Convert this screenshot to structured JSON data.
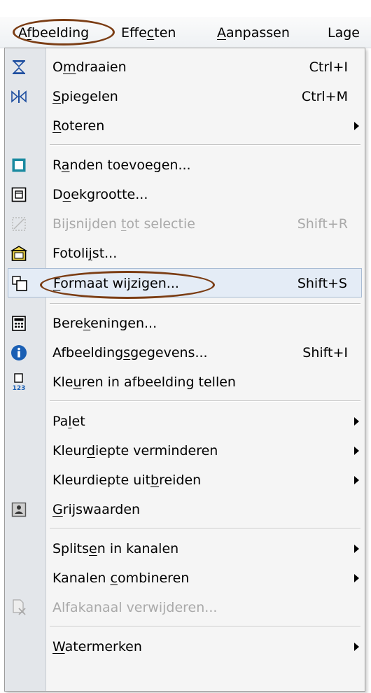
{
  "menubar": {
    "items": [
      {
        "label": "Afbeelding"
      },
      {
        "label": "Effecten"
      },
      {
        "label": "Aanpassen"
      },
      {
        "label": "Lage"
      }
    ]
  },
  "menu": {
    "items": [
      {
        "label": "Omdraaien",
        "shortcut": "Ctrl+I",
        "icon": "flip-vertical-icon"
      },
      {
        "label": "Spiegelen",
        "shortcut": "Ctrl+M",
        "icon": "mirror-icon"
      },
      {
        "label": "Roteren",
        "submenu": true
      },
      {
        "label": "Randen toevoegen...",
        "icon": "add-border-icon"
      },
      {
        "label": "Doekgrootte...",
        "icon": "canvas-size-icon"
      },
      {
        "label": "Bijsnijden tot selectie",
        "shortcut": "Shift+R",
        "icon": "crop-icon",
        "disabled": true
      },
      {
        "label": "Fotolijst...",
        "icon": "frame-icon"
      },
      {
        "label": "Formaat wijzigen...",
        "shortcut": "Shift+S",
        "icon": "resize-icon",
        "selected": true
      },
      {
        "label": "Berekeningen...",
        "icon": "calculator-icon"
      },
      {
        "label": "Afbeeldingsgegevens...",
        "shortcut": "Shift+I",
        "icon": "info-icon"
      },
      {
        "label": "Kleuren in afbeelding tellen",
        "icon": "count-colors-icon"
      },
      {
        "label": "Palet",
        "submenu": true
      },
      {
        "label": "Kleurdiepte verminderen",
        "submenu": true
      },
      {
        "label": "Kleurdiepte uitbreiden",
        "submenu": true
      },
      {
        "label": "Grijswaarden",
        "icon": "grayscale-icon"
      },
      {
        "label": "Splitsen in kanalen",
        "submenu": true
      },
      {
        "label": "Kanalen combineren",
        "submenu": true
      },
      {
        "label": "Alfakanaal verwijderen...",
        "icon": "delete-alpha-icon",
        "disabled": true
      },
      {
        "label": "Watermerken",
        "submenu": true
      }
    ]
  },
  "colors": {
    "annotation": "#7b3d14",
    "info_icon": "#1a5fb4",
    "frame_fill": "#f0d64c"
  }
}
